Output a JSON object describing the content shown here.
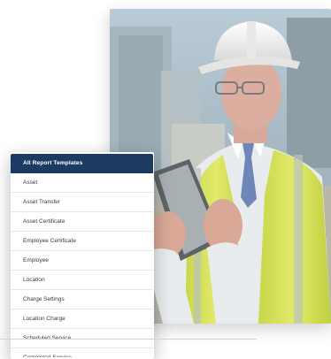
{
  "panel": {
    "header": "All Report Templates",
    "items": [
      "Asset",
      "Asset Transfer",
      "Asset Certificate",
      "Employee Certificate",
      "Employee",
      "Location",
      "Charge Settings",
      "Location Charge",
      "Scheduled Service",
      "Completed Service"
    ]
  },
  "colors": {
    "header_bg": "#1c3b63",
    "vest": "#d6e24a",
    "hard_hat": "#f2f2f0"
  }
}
